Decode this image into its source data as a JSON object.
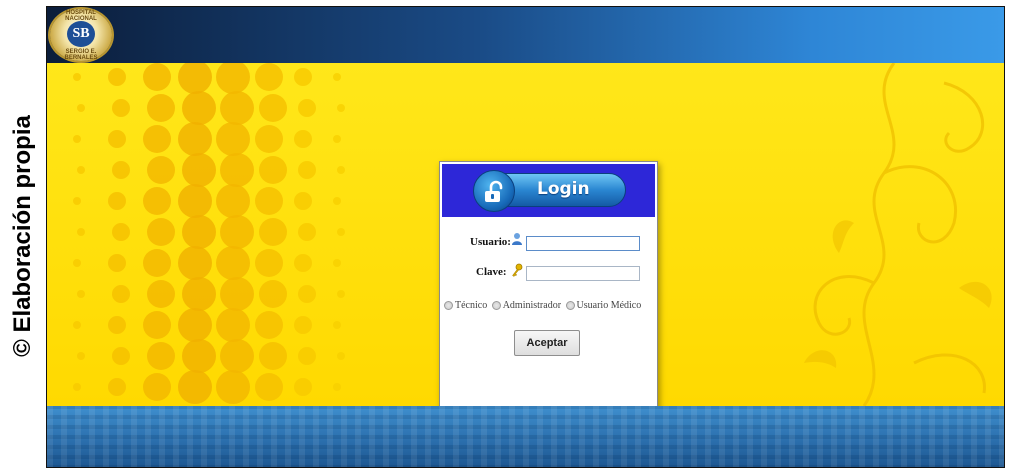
{
  "caption": "© Elaboración propia",
  "header": {
    "logo": {
      "top_text": "HOSPITAL NACIONAL",
      "monogram": "SB",
      "bottom_text": "SERGIO E. BERNALES"
    }
  },
  "login": {
    "title": "Login",
    "fields": {
      "user_label": "Usuario:",
      "user_value": "",
      "password_label": "Clave:",
      "password_value": ""
    },
    "roles": [
      {
        "label": "Técnico",
        "selected": false
      },
      {
        "label": "Administrador",
        "selected": false
      },
      {
        "label": "Usuario Médico",
        "selected": false
      }
    ],
    "submit_label": "Aceptar"
  },
  "colors": {
    "header_dark": "#0b1d3a",
    "header_light": "#3a9ae8",
    "stage_yellow": "#ffe71a",
    "login_header": "#2d27d8",
    "footer_blue": "#2b6fad"
  },
  "icons": [
    "lock-icon",
    "user-icon",
    "key-icon"
  ]
}
